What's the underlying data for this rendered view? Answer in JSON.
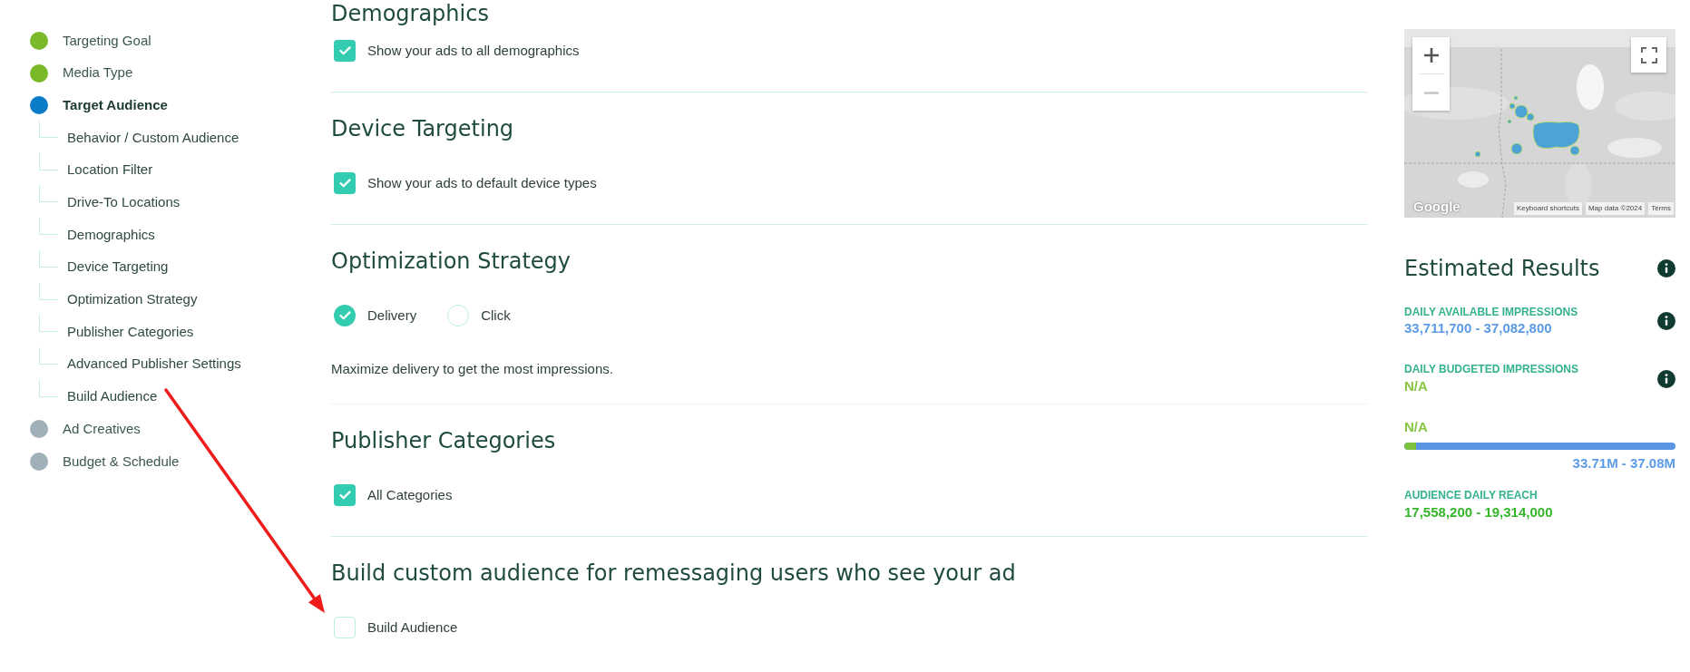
{
  "sidebar": {
    "steps": [
      {
        "label": "Targeting Goal",
        "color": "#7ab929",
        "selected": false
      },
      {
        "label": "Media Type",
        "color": "#7ab929",
        "selected": false
      },
      {
        "label": "Target Audience",
        "color": "#0b7dc8",
        "selected": true,
        "children": [
          {
            "label": "Behavior / Custom Audience"
          },
          {
            "label": "Location Filter"
          },
          {
            "label": "Drive-To Locations"
          },
          {
            "label": "Demographics"
          },
          {
            "label": "Device Targeting"
          },
          {
            "label": "Optimization Strategy"
          },
          {
            "label": "Publisher Categories"
          },
          {
            "label": "Advanced Publisher Settings"
          },
          {
            "label": "Build Audience"
          }
        ]
      },
      {
        "label": "Ad Creatives",
        "color": "#9fb0b8",
        "selected": false
      },
      {
        "label": "Budget & Schedule",
        "color": "#9fb0b8",
        "selected": false
      }
    ]
  },
  "sections": [
    {
      "title": "Demographics",
      "options": [
        {
          "kind": "checkbox",
          "label": "Show your ads to all demographics",
          "checked": true
        }
      ]
    },
    {
      "title": "Device Targeting",
      "options": [
        {
          "kind": "checkbox",
          "label": "Show your ads to default device types",
          "checked": true
        }
      ]
    },
    {
      "title": "Optimization Strategy",
      "options": [
        {
          "kind": "radio",
          "label": "Delivery",
          "selected": true
        },
        {
          "kind": "radio",
          "label": "Click",
          "selected": false
        }
      ],
      "description": "Maximize delivery to get the most impressions."
    },
    {
      "title": "Publisher Categories",
      "options": [
        {
          "kind": "checkbox",
          "label": "All Categories",
          "checked": true
        }
      ]
    },
    {
      "title": "Build custom audience for remessaging users who see your ad",
      "options": [
        {
          "kind": "checkbox",
          "label": "Build Audience",
          "checked": false
        }
      ]
    }
  ],
  "map": {
    "logo": "Google",
    "attribution": [
      "Keyboard shortcuts",
      "Map data ©2024",
      "Terms"
    ]
  },
  "estimated_results": {
    "title": "Estimated Results",
    "available_impressions": {
      "label": "DAILY AVAILABLE IMPRESSIONS",
      "value": "33,711,700 - 37,082,800"
    },
    "budgeted_impressions": {
      "label": "DAILY BUDGETED IMPRESSIONS",
      "value": "N/A"
    },
    "comparison": {
      "budgeted": "N/A",
      "level": 0.045,
      "available": "33.71M - 37.08M"
    },
    "audience_reach": {
      "label": "AUDIENCE DAILY REACH",
      "value": "17,558,200 - 19,314,000"
    }
  }
}
